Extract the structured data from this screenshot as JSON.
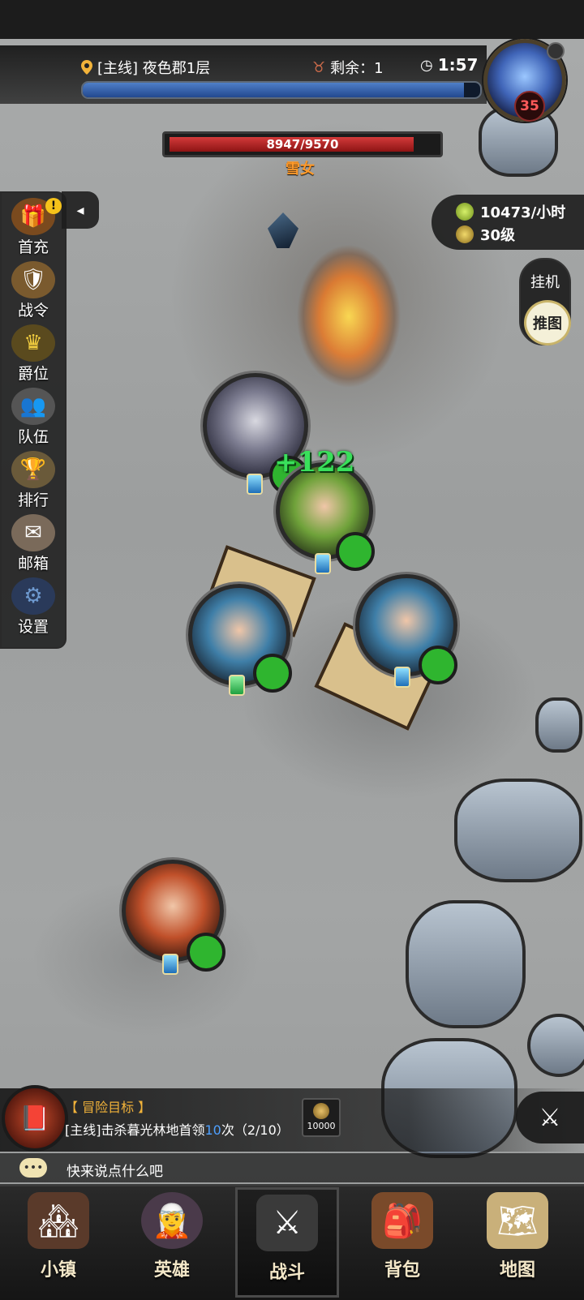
{
  "header": {
    "quest_location": "[主线] 夜色郡1层",
    "remaining_label": "剩余：1",
    "timer": "1:57",
    "progress_fraction": 0.96,
    "boss_level": "35"
  },
  "enemy": {
    "hp_text": "8947/9570",
    "hp_current": 8947,
    "hp_max": 9570,
    "name": "雪女"
  },
  "side_menu": [
    {
      "label": "首充",
      "icon": "treasure-chest-icon",
      "alert": "!"
    },
    {
      "label": "战令",
      "icon": "war-order-icon"
    },
    {
      "label": "爵位",
      "icon": "crown-icon"
    },
    {
      "label": "队伍",
      "icon": "team-icon"
    },
    {
      "label": "排行",
      "icon": "ranking-icon"
    },
    {
      "label": "邮箱",
      "icon": "mail-icon"
    },
    {
      "label": "设置",
      "icon": "gear-icon"
    }
  ],
  "income": {
    "rate": "10473/小时",
    "level": "30级"
  },
  "mode": {
    "idle": "挂机",
    "push": "推图"
  },
  "battle": {
    "heal_text": "+122"
  },
  "target": {
    "title": "【 冒险目标 】",
    "desc_prefix": "[主线]击杀暮光林地首领",
    "desc_count": "10",
    "desc_suffix": "次（2/10）",
    "reward": "10000"
  },
  "chat": {
    "placeholder": "快来说点什么吧"
  },
  "bottom_nav": [
    {
      "label": "小镇",
      "icon": "town-icon"
    },
    {
      "label": "英雄",
      "icon": "hero-icon"
    },
    {
      "label": "战斗",
      "icon": "battle-icon",
      "active": true
    },
    {
      "label": "背包",
      "icon": "backpack-icon"
    },
    {
      "label": "地图",
      "icon": "map-icon"
    }
  ],
  "colors": {
    "hp_red": "#c42828",
    "heal_green": "#39e05b",
    "enemy_name": "#ff9a2a",
    "progress_blue": "#3562aa"
  }
}
